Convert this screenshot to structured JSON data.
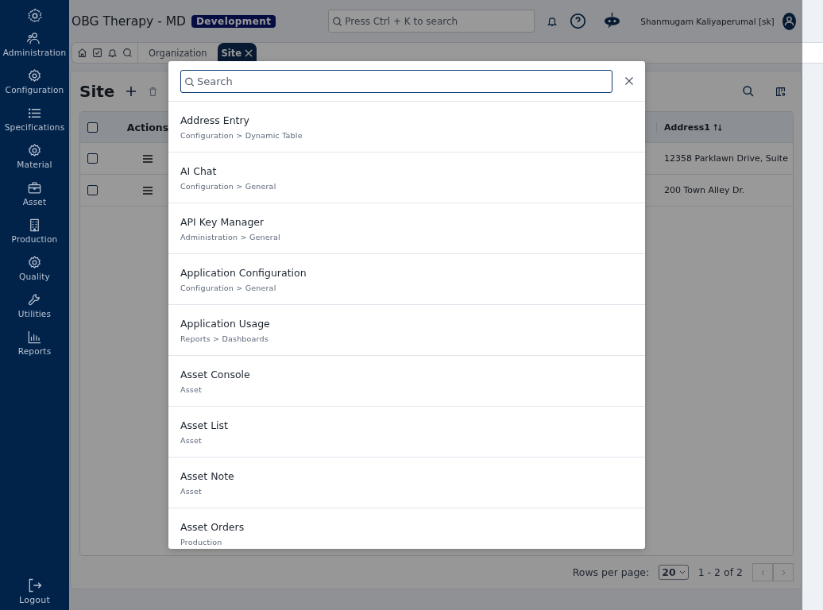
{
  "sidebar": {
    "items": [
      {
        "label": "Administration"
      },
      {
        "label": "Configuration"
      },
      {
        "label": "Specifications"
      },
      {
        "label": "Material"
      },
      {
        "label": "Asset"
      },
      {
        "label": "Production"
      },
      {
        "label": "Quality"
      },
      {
        "label": "Utilities"
      },
      {
        "label": "Reports"
      }
    ],
    "logout": "Logout"
  },
  "header": {
    "title": "OBG Therapy - MD",
    "environment": "Development",
    "search_placeholder": "Press Ctrl + K to search",
    "user_name": "Shanmugam Kaliyaperumal [sk]"
  },
  "tabs": [
    {
      "label": "Organization",
      "selected": false
    },
    {
      "label": "Site",
      "selected": true
    }
  ],
  "page": {
    "title": "Site"
  },
  "table": {
    "header_checked": false,
    "columns": [
      "Actions",
      "Address1"
    ],
    "rows": [
      {
        "checked": false,
        "address1": "12358 Parklawn Drive, Suite"
      },
      {
        "checked": false,
        "address1": "200 Town Alley Dr."
      }
    ]
  },
  "pagination": {
    "rows_per_page_label": "Rows per page:",
    "rows_per_page": "20",
    "range": "1 - 2 of 2"
  },
  "search_dialog": {
    "placeholder": "Search",
    "results": [
      {
        "title": "Address Entry",
        "path": "Configuration > Dynamic Table"
      },
      {
        "title": "AI Chat",
        "path": "Configuration > General"
      },
      {
        "title": "API Key Manager",
        "path": "Administration > General"
      },
      {
        "title": "Application Configuration",
        "path": "Configuration > General"
      },
      {
        "title": "Application Usage",
        "path": "Reports > Dashboards"
      },
      {
        "title": "Asset Console",
        "path": "Asset"
      },
      {
        "title": "Asset List",
        "path": "Asset"
      },
      {
        "title": "Asset Note",
        "path": "Asset"
      },
      {
        "title": "Asset Orders",
        "path": "Production"
      }
    ]
  }
}
